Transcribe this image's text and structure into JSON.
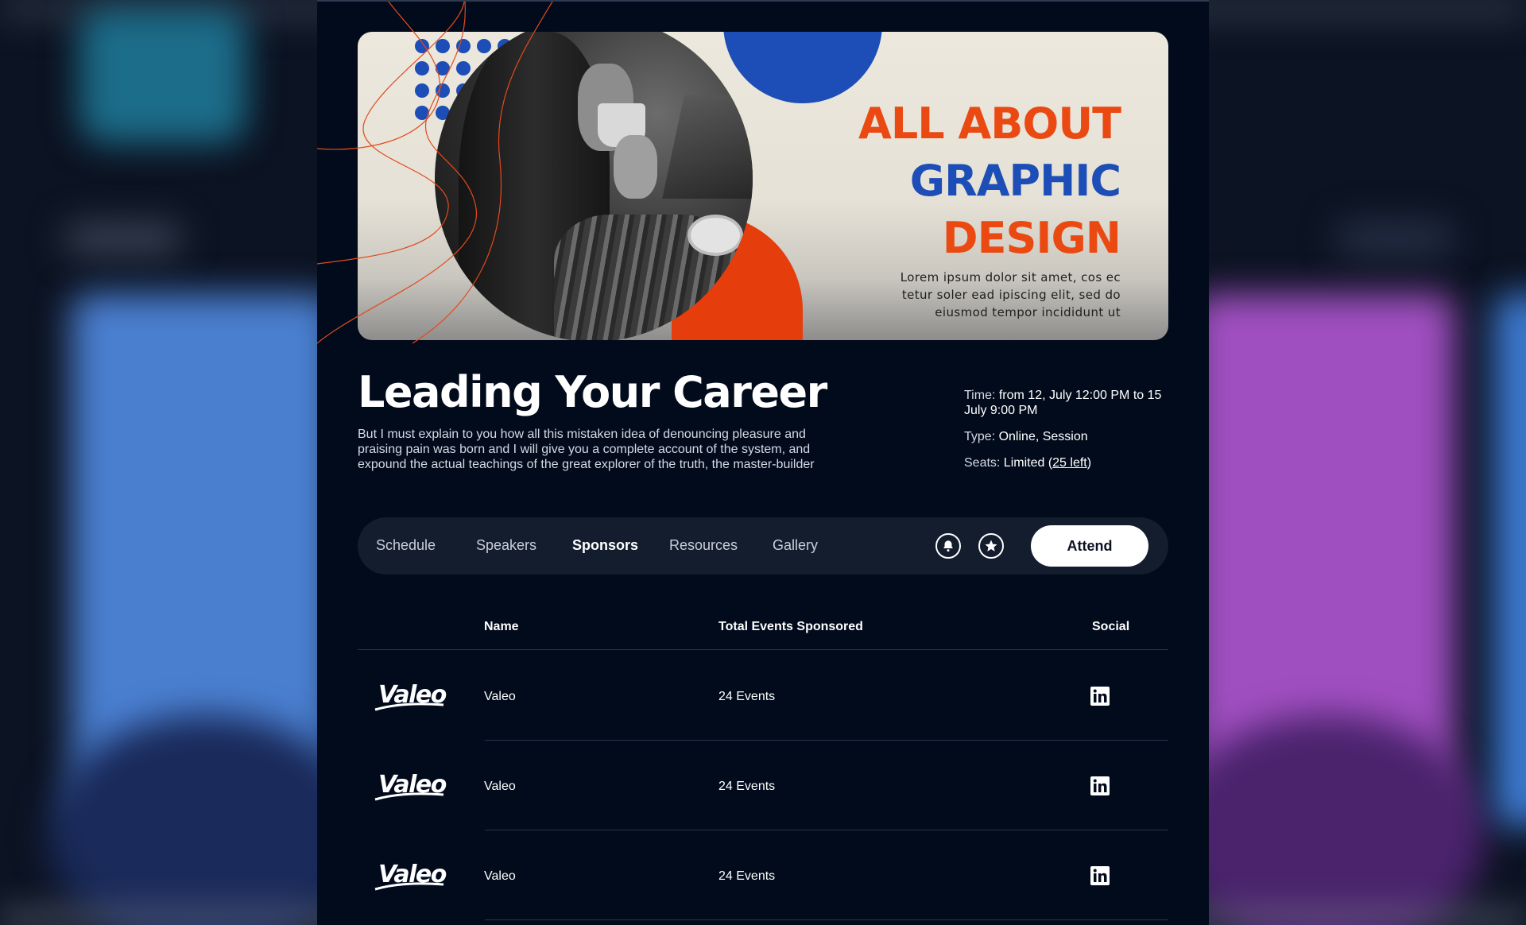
{
  "banner": {
    "title_line1": "ALL ABOUT",
    "title_line2": "GRAPHIC",
    "title_line3": "DESIGN",
    "subtitle_line1": "Lorem ipsum dolor sit amet, cos ec",
    "subtitle_line2": "tetur soler ead ipiscing elit, sed do",
    "subtitle_line3": "eiusmod tempor incididunt ut"
  },
  "event": {
    "title": "Leading Your Career",
    "description": "But I must explain to you how all this mistaken idea of denouncing pleasure and praising pain was born and I will give you a complete account of the system, and expound the actual teachings of the great explorer of the truth, the master-builder"
  },
  "info": {
    "time_label": "Time:",
    "time_value": " from 12, July 12:00 PM to 15 July 9:00 PM",
    "type_label": "Type:",
    "type_value": " Online, Session",
    "seats_label": "Seats:",
    "seats_value_prefix": " Limited (",
    "seats_link": "25 left",
    "seats_value_suffix": ")"
  },
  "tabs": {
    "items": [
      {
        "label": "Schedule"
      },
      {
        "label": "Speakers"
      },
      {
        "label": "Sponsors"
      },
      {
        "label": "Resources"
      },
      {
        "label": "Gallery"
      }
    ],
    "active": "Sponsors",
    "bell_icon": "bell-icon",
    "star_icon": "star-icon",
    "attend_label": "Attend"
  },
  "table": {
    "headers": {
      "name": "Name",
      "events": "Total Events Sponsored",
      "social": "Social"
    },
    "rows": [
      {
        "logo": "Valeo",
        "name": "Valeo",
        "events": "24 Events",
        "social_icon": "linkedin-icon"
      },
      {
        "logo": "Valeo",
        "name": "Valeo",
        "events": "24 Events",
        "social_icon": "linkedin-icon"
      },
      {
        "logo": "Valeo",
        "name": "Valeo",
        "events": "24 Events",
        "social_icon": "linkedin-icon"
      }
    ]
  },
  "colors": {
    "panel_bg": "#020b1c",
    "accent_orange": "#ea4a12",
    "accent_blue": "#1d4db6",
    "tabbar_bg": "#131d2e"
  }
}
